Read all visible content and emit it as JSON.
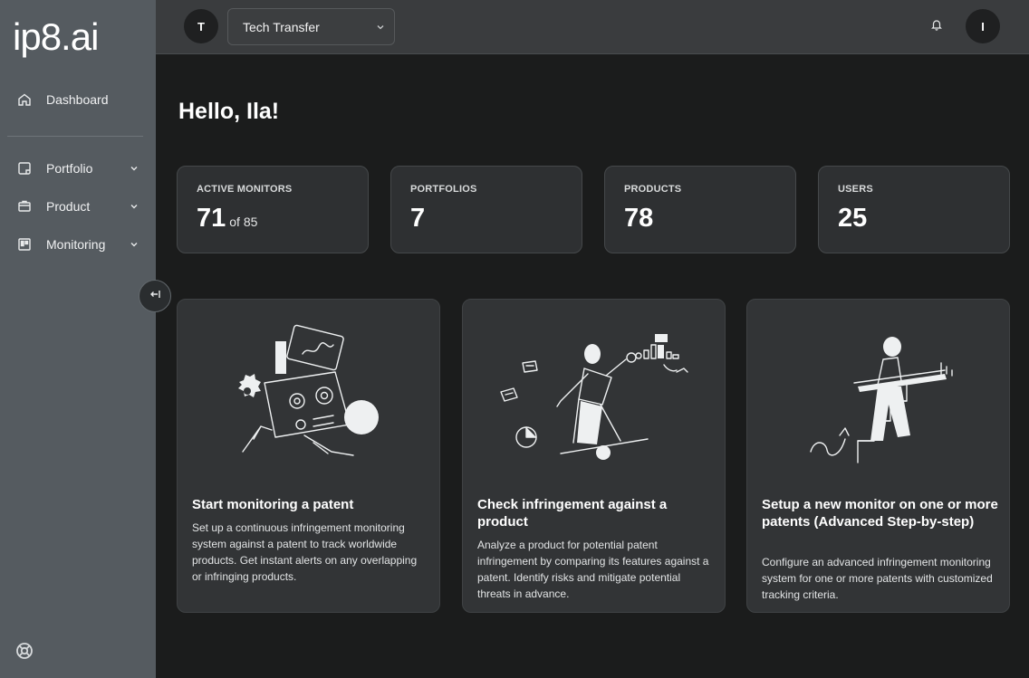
{
  "app": {
    "logo": "ip8.ai"
  },
  "sidebar": {
    "items": [
      {
        "label": "Dashboard",
        "icon": "home-icon"
      },
      {
        "label": "Portfolio",
        "icon": "portfolio-icon"
      },
      {
        "label": "Product",
        "icon": "box-icon"
      },
      {
        "label": "Monitoring",
        "icon": "monitoring-icon"
      }
    ],
    "collapse_icon": "collapse-left-icon",
    "help_icon": "lifebuoy-icon"
  },
  "topbar": {
    "org_initial": "T",
    "org_name": "Tech Transfer",
    "user_initial": "I"
  },
  "main": {
    "greeting": "Hello, Ila!",
    "stats": [
      {
        "label": "ACTIVE MONITORS",
        "value": "71",
        "suffix": "of 85"
      },
      {
        "label": "PORTFOLIOS",
        "value": "7"
      },
      {
        "label": "PRODUCTS",
        "value": "78"
      },
      {
        "label": "USERS",
        "value": "25"
      }
    ],
    "actions": [
      {
        "title": "Start monitoring a patent",
        "description": "Set up a continuous infringement monitoring system against a patent to track worldwide products. Get instant alerts on any overlapping or infringing products."
      },
      {
        "title": "Check infringement against a product",
        "description": "Analyze a product for potential patent infringement by comparing its features against a patent. Identify risks and mitigate potential threats in advance."
      },
      {
        "title": "Setup a new monitor on one or more patents (Advanced Step-by-step)",
        "description": "Configure an advanced infringement monitoring system for one or more patents with customized tracking criteria."
      }
    ]
  }
}
